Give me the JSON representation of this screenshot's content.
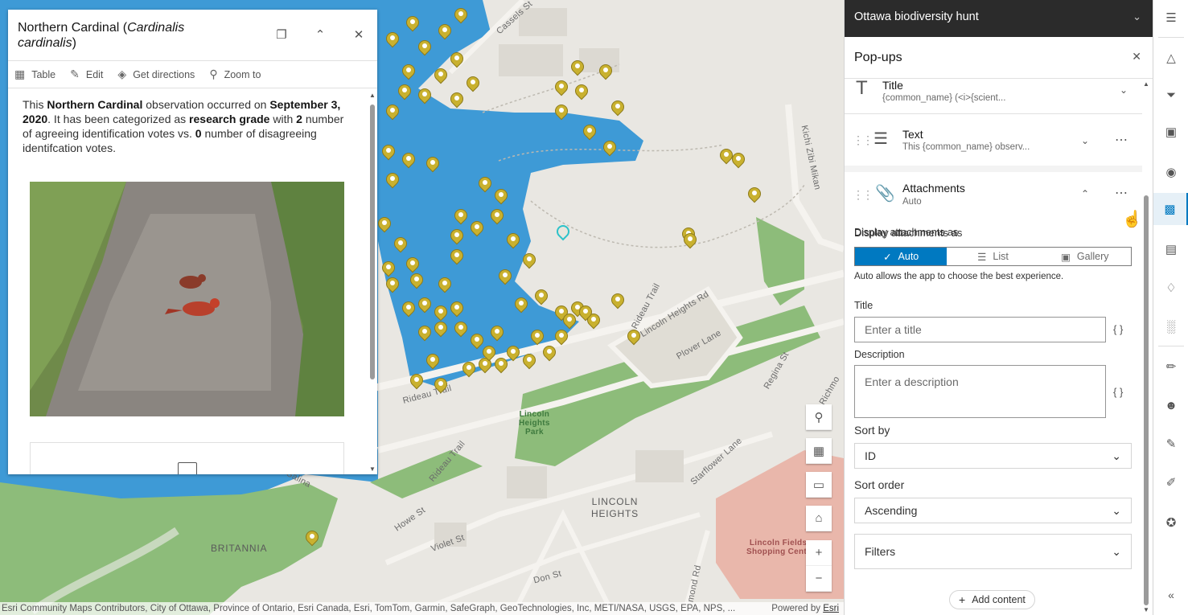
{
  "map": {
    "labels": {
      "cassels": "Cassels St",
      "kichi": "Kichi Zibi Mikan",
      "rideau1": "Rideau Trail",
      "rideau2": "Rideau Trail",
      "rideau3": "Rideau Trail",
      "lincolnrd": "Lincoln Heights Rd",
      "plover": "Plover Lane",
      "regina": "Regina St",
      "richmo": "Richmo",
      "starflower": "Starflower Lane",
      "salina": "Salina",
      "howe": "Howe St",
      "violet": "Violet St",
      "don": "Don St",
      "mond": "mond Rd",
      "park": "Lincoln\nHeights\nPark",
      "lincolnheights": "LINCOLN\nHEIGHTS",
      "britannia": "BRITANNIA",
      "shopping": "Lincoln Fields\nShopping Centr"
    },
    "attribution": "Esri Community Maps Contributors, City of Ottawa, Province of Ontario, Esri Canada, Esri, TomTom, Garmin, SafeGraph, GeoTechnologies, Inc, METI/NASA, USGS, EPA, NPS, ...",
    "powered_by": "Powered by",
    "esri": "Esri",
    "tools": {
      "search": "search-icon",
      "basemap": "basemap-icon",
      "fullscreen": "fullscreen-icon",
      "home": "home-icon",
      "zoom_in": "+",
      "zoom_out": "−"
    },
    "pin_color": "#c9b12f",
    "selected_color": "#2cc2c9"
  },
  "popup": {
    "title_common": "Northern Cardinal (",
    "title_scientific": "Cardinalis cardinalis",
    "title_end": ")",
    "actions": {
      "table": "Table",
      "edit": "Edit",
      "directions": "Get directions",
      "zoom": "Zoom to"
    },
    "text": {
      "t1": "This ",
      "bird": "Northern Cardinal",
      "t2": " observation occurred on ",
      "date": "September 3, 2020",
      "t3": ". It has been categorized as ",
      "grade": "research grade",
      "t4": " with ",
      "agree": "2",
      "t5": " number of agreeing identification votes vs. ",
      "disagree": "0",
      "t6": " number of disagreeing identifcation votes."
    }
  },
  "panel": {
    "app_title": "Ottawa biodiversity hunt",
    "heading": "Pop-ups",
    "title_block": {
      "label": "Title",
      "sub": "{common_name} (<i>{scient..."
    },
    "text_block": {
      "label": "Text",
      "sub": "This {common_name} observ..."
    },
    "attach_block": {
      "label": "Attachments",
      "sub": "Auto"
    },
    "display_as": "Display attachments as",
    "seg": {
      "auto": "Auto",
      "list": "List",
      "gallery": "Gallery"
    },
    "hint": "Auto allows the app to choose the best experience.",
    "title_label": "Title",
    "title_placeholder": "Enter a title",
    "desc_label": "Description",
    "desc_placeholder": "Enter a description",
    "braces": "{ }",
    "sort_by_label": "Sort by",
    "sort_by_value": "ID",
    "sort_order_label": "Sort order",
    "sort_order_value": "Ascending",
    "filters": "Filters",
    "add_content": "Add content"
  },
  "theme": {
    "accent": "#0079c1",
    "appbar": "#2b2b2b"
  }
}
